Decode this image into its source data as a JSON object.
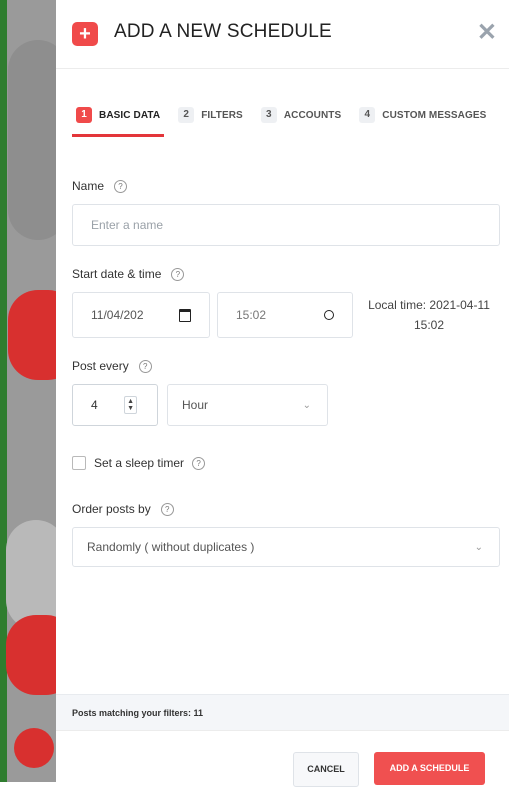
{
  "header": {
    "title": "ADD A NEW SCHEDULE",
    "close_icon": "close-icon",
    "add_icon": "plus-icon"
  },
  "tabs": [
    {
      "num": "1",
      "label": "BASIC DATA"
    },
    {
      "num": "2",
      "label": "FILTERS"
    },
    {
      "num": "3",
      "label": "ACCOUNTS"
    },
    {
      "num": "4",
      "label": "CUSTOM MESSAGES"
    }
  ],
  "form": {
    "name": {
      "label": "Name",
      "placeholder": "Enter a name",
      "help_icon": "question-icon"
    },
    "start": {
      "label": "Start date & time",
      "date_value": "11/04/202",
      "time_value": "15:02",
      "local_time_line1": "Local time: 2021-04-11",
      "local_time_line2": "15:02"
    },
    "post_every": {
      "label": "Post every",
      "value": "4",
      "unit": "Hour"
    },
    "sleep_timer": {
      "label": "Set a sleep timer",
      "checked": false
    },
    "order": {
      "label": "Order posts by",
      "value": "Randomly ( without duplicates )"
    }
  },
  "footer": {
    "matching_text": "Posts matching your filters: 11",
    "cancel_label": "CANCEL",
    "add_label": "ADD A SCHEDULE"
  },
  "colors": {
    "accent": "#f04a4a",
    "tab_underline": "#e3353a"
  }
}
